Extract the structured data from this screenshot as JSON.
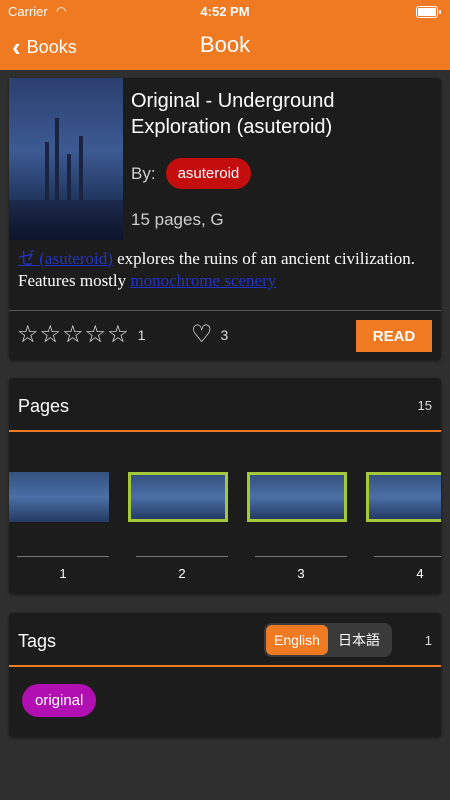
{
  "status_bar": {
    "carrier": "Carrier",
    "time": "4:52 PM"
  },
  "nav": {
    "back_label": "Books",
    "title": "Book"
  },
  "book": {
    "title": "Original - Underground Exploration (asuteroid)",
    "by_label": "By:",
    "author": "asuteroid",
    "page_info": "15 pages, G",
    "description": {
      "link1": "ゼ (asuteroid)",
      "text1": " explores the ruins of an ancient civilization. Features mostly ",
      "link2": "monochrome scenery"
    },
    "rating_count": "1",
    "favorites_count": "3",
    "read_label": "READ",
    "rating_value": 0
  },
  "pages": {
    "title": "Pages",
    "count": "15",
    "thumbnails": [
      {
        "number": "1",
        "selected": false
      },
      {
        "number": "2",
        "selected": true
      },
      {
        "number": "3",
        "selected": true
      },
      {
        "number": "4",
        "selected": true
      }
    ]
  },
  "tags": {
    "title": "Tags",
    "count": "1",
    "languages": [
      "English",
      "日本語"
    ],
    "active_language": "English",
    "items": [
      "original"
    ]
  },
  "colors": {
    "accent": "#f07a22",
    "author_chip": "#c40e0e",
    "tag_chip": "#b20fb2",
    "thumb_border": "#a4c83a",
    "link": "#2233c6"
  }
}
